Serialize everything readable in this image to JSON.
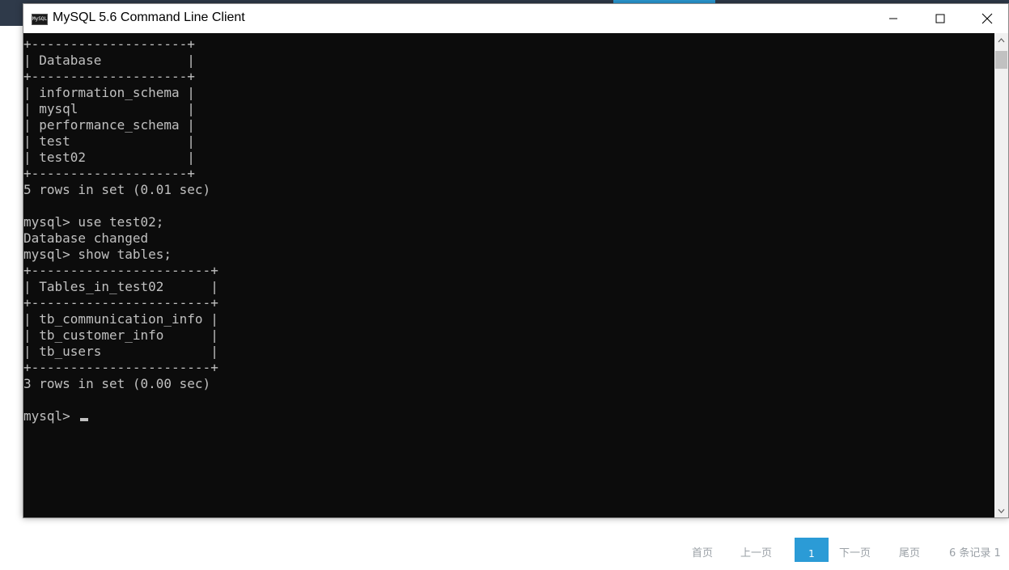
{
  "window": {
    "title": "MySQL 5.6 Command Line Client",
    "icon_label": "MySQL"
  },
  "console": {
    "lines": [
      "+--------------------+",
      "| Database           |",
      "+--------------------+",
      "| information_schema |",
      "| mysql              |",
      "| performance_schema |",
      "| test               |",
      "| test02             |",
      "+--------------------+",
      "5 rows in set (0.01 sec)",
      "",
      "mysql> use test02;",
      "Database changed",
      "mysql> show tables;",
      "+-----------------------+",
      "| Tables_in_test02      |",
      "+-----------------------+",
      "| tb_communication_info |",
      "| tb_customer_info      |",
      "| tb_users              |",
      "+-----------------------+",
      "3 rows in set (0.00 sec)",
      "",
      "mysql> "
    ]
  },
  "colors": {
    "console_bg": "#0c0c0c",
    "console_text": "#c0c0c0",
    "accent": "#2b9bd6"
  },
  "pager": {
    "first": "首页",
    "prev": "上一页",
    "current": "1",
    "next": "下一页",
    "last": "尾页",
    "count": "6  条记录  1"
  }
}
